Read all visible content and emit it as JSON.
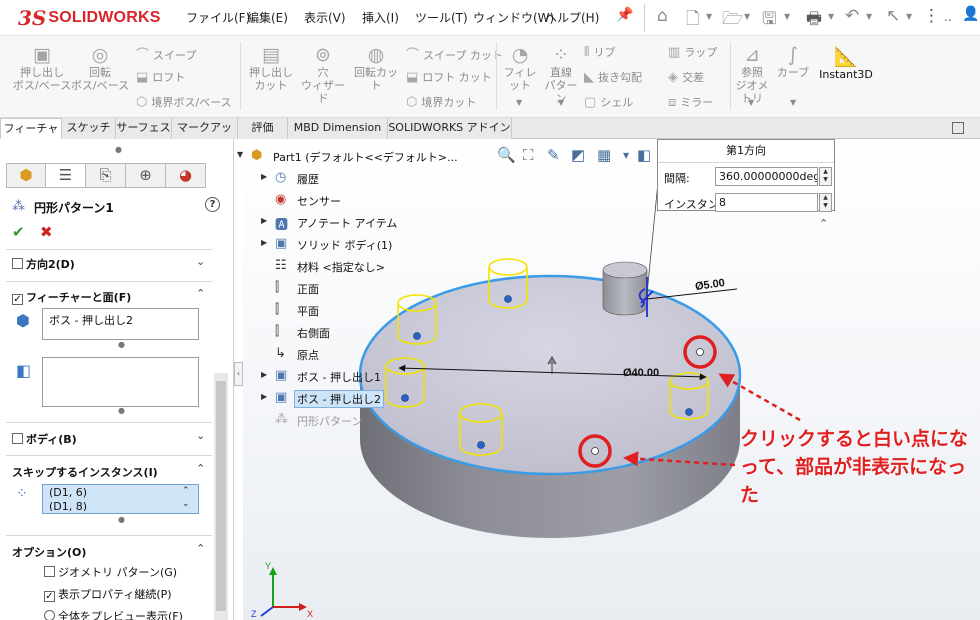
{
  "app": {
    "logo_ds": "3S",
    "logo_word": "SOLIDWORKS"
  },
  "menu": [
    "ファイル(F)",
    "編集(E)",
    "表示(V)",
    "挿入(I)",
    "ツール(T)",
    "ウィンドウ(W)",
    "ヘルプ(H)"
  ],
  "ribbon": {
    "extrude_boss": "押し出し\nボス/ベース",
    "revolve_boss": "回転\nボス/ベース",
    "sweep": "スイープ",
    "loft": "ロフト",
    "boundary_boss": "境界ボス/ベース",
    "extrude_cut": "押し出し\nカット",
    "hole_wizard": "穴\nウィザード",
    "revolve_cut": "回転カット",
    "swept_cut": "スイープ カット",
    "lofted_cut": "ロフト カット",
    "boundary_cut": "境界カット",
    "fillet": "フィレット",
    "linear_pattern": "直線\nパターン",
    "rib": "リブ",
    "draft": "抜き勾配",
    "shell": "シェル",
    "wrap": "ラップ",
    "intersect": "交差",
    "mirror": "ミラー",
    "ref_geometry": "参照\nジオメトリ",
    "curves": "カーブ",
    "instant3d": "Instant3D"
  },
  "tabs": [
    "フィーチャー",
    "スケッチ",
    "サーフェス",
    "マークアップ",
    "評価",
    "MBD Dimension",
    "SOLIDWORKS アドイン"
  ],
  "tabs_active": 0,
  "property_manager": {
    "title": "円形パターン1",
    "help": "?",
    "ok": "✔",
    "cancel": "✖",
    "direction2": {
      "label": "方向2(D)",
      "checked": false
    },
    "features_faces": {
      "label": "フィーチャーと面(F)",
      "checked": true,
      "item": "ボス - 押し出し2"
    },
    "bodies": {
      "label": "ボディ(B)",
      "checked": false
    },
    "skip_instances": {
      "label": "スキップするインスタンス(I)",
      "items": [
        "(D1, 6)",
        "(D1, 8)"
      ]
    },
    "options": {
      "label": "オプション(O)",
      "geometry_pattern": {
        "label": "ジオメトリ パターン(G)",
        "checked": false
      },
      "propagate_visual": {
        "label": "表示プロパティ継続(P)",
        "checked": true
      },
      "full_preview": {
        "label": "全体をプレビュー表示(F)"
      }
    }
  },
  "feature_tree": [
    {
      "label": "Part1 (デフォルト<<デフォルト>...",
      "icon": "part-icon",
      "arrow": "▼"
    },
    {
      "label": "履歴",
      "icon": "history-icon",
      "arrow": "▶"
    },
    {
      "label": "センサー",
      "icon": "sensor-icon",
      "arrow": ""
    },
    {
      "label": "アノテート アイテム",
      "icon": "annotation-icon",
      "arrow": "▶"
    },
    {
      "label": "ソリッド ボディ(1)",
      "icon": "solid-body-icon",
      "arrow": "▶"
    },
    {
      "label": "材料 <指定なし>",
      "icon": "material-icon",
      "arrow": ""
    },
    {
      "label": "正面",
      "icon": "plane-icon",
      "arrow": ""
    },
    {
      "label": "平面",
      "icon": "plane-icon",
      "arrow": ""
    },
    {
      "label": "右側面",
      "icon": "plane-icon",
      "arrow": ""
    },
    {
      "label": "原点",
      "icon": "origin-icon",
      "arrow": ""
    },
    {
      "label": "ボス - 押し出し1",
      "icon": "extrude-icon",
      "arrow": "▶"
    },
    {
      "label": "ボス - 押し出し2",
      "icon": "extrude-icon",
      "arrow": "▶",
      "selected": true
    },
    {
      "label": "円形パターン",
      "icon": "circular-pattern-icon",
      "arrow": "",
      "ghost": true
    }
  ],
  "direction_popup": {
    "title": "第1方向",
    "spacing_label": "間隔:",
    "spacing_value": "360.00000000deg",
    "instances_label": "インスタンス:",
    "instances_value": "8"
  },
  "dimensions": {
    "small": "Ø5.00",
    "large": "Ø40.00"
  },
  "annotation": {
    "text": "クリックすると白い点になって、部品が非表示になった",
    "color": "#e02020"
  },
  "colors": {
    "accent": "#2e73c8",
    "brand": "#d8242b",
    "highlight": "#ffff00",
    "annotation": "#e02020"
  }
}
